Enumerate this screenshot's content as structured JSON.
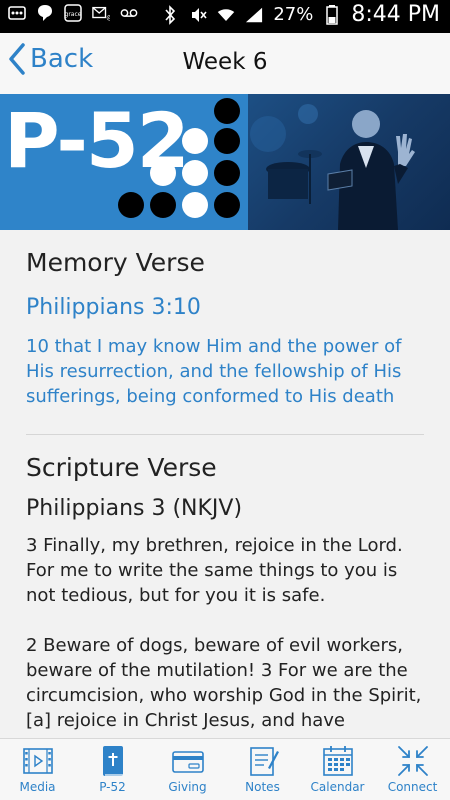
{
  "statusbar": {
    "battery_pct": "27%",
    "time": "8:44 PM"
  },
  "header": {
    "back_label": "Back",
    "title": "Week 6"
  },
  "banner": {
    "text": "P-52"
  },
  "memory": {
    "heading": "Memory Verse",
    "reference": "Philippians 3:10",
    "verse": "10 that I may know Him and the power of His resurrection, and the fellowship of His sufferings, being conformed to His death"
  },
  "scripture": {
    "heading": "Scripture Verse",
    "title": "Philippians 3 (NKJV)",
    "paragraph1": "3 Finally, my brethren, rejoice in the Lord. For me to write the same things to you is not tedious, but for you it is safe.",
    "paragraph2": "2 Beware of dogs, beware of evil workers, beware of the mutilation! 3 For we are the circumcision, who worship God in the Spirit,[a] rejoice in Christ Jesus, and have"
  },
  "tabs": [
    {
      "label": "Media",
      "icon": "film-icon"
    },
    {
      "label": "P-52",
      "icon": "bible-icon"
    },
    {
      "label": "Giving",
      "icon": "card-icon"
    },
    {
      "label": "Notes",
      "icon": "notes-icon"
    },
    {
      "label": "Calendar",
      "icon": "calendar-icon"
    },
    {
      "label": "Connect",
      "icon": "connect-icon"
    }
  ],
  "colors": {
    "accent": "#2e82c8",
    "banner_blue": "#2f84c9",
    "statusbar": "#000000"
  }
}
